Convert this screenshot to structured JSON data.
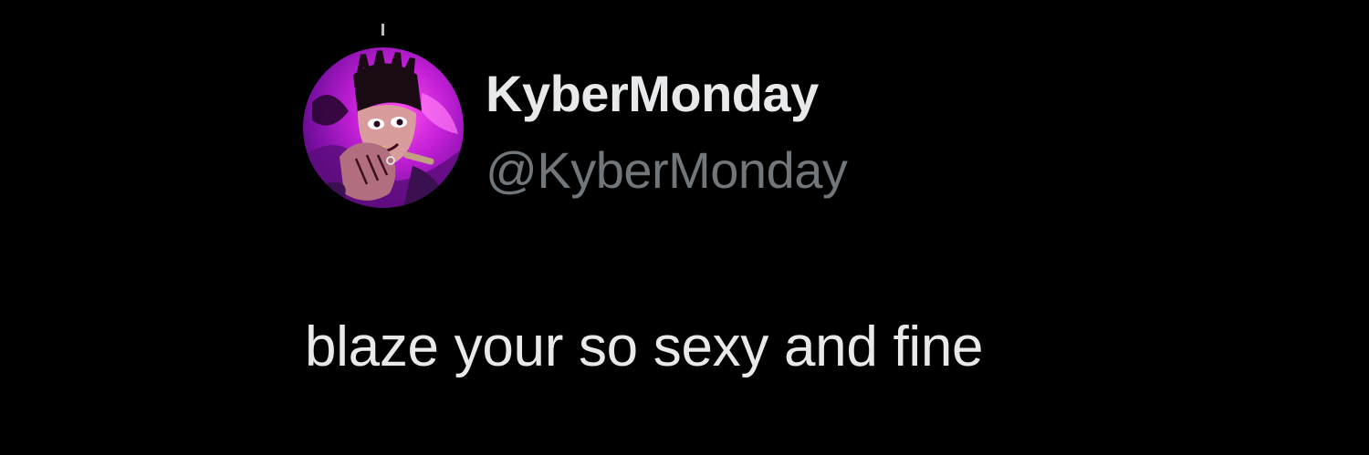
{
  "profile": {
    "display_name": "KyberMonday",
    "handle": "@KyberMonday",
    "avatar_icon": "avatar-illustration"
  },
  "tweet": {
    "text": "blaze your so sexy and fine"
  },
  "colors": {
    "background": "#000000",
    "primary_text": "#e7e9ea",
    "secondary_text": "#71767b",
    "avatar_accent": "#c21fd6"
  }
}
